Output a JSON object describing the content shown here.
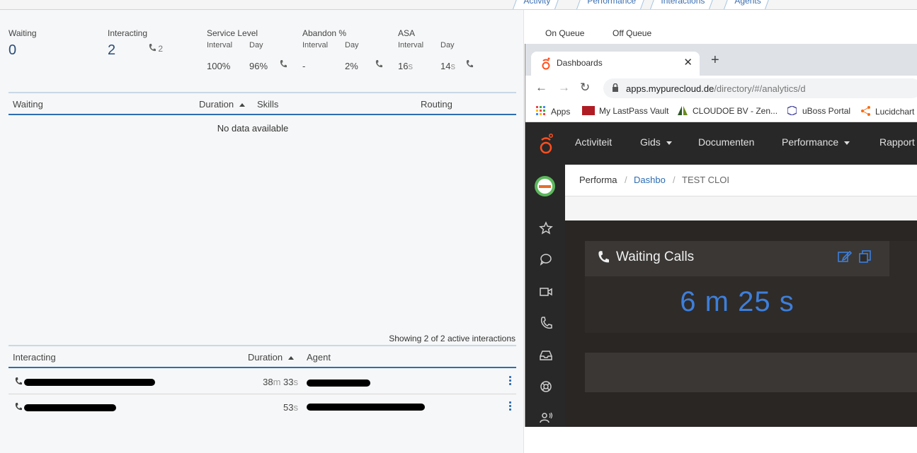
{
  "top_tabs": [
    "Activity",
    "Performance",
    "Interactions",
    "Agents"
  ],
  "stats": {
    "waiting_label": "Waiting",
    "waiting_value": "0",
    "interacting_label": "Interacting",
    "interacting_value": "2",
    "interacting_calls": "2",
    "service_level_label": "Service Level",
    "service_interval_label": "Interval",
    "service_day_label": "Day",
    "service_interval_value": "100%",
    "service_day_value": "96%",
    "abandon_label": "Abandon %",
    "abandon_interval_label": "Interval",
    "abandon_day_label": "Day",
    "abandon_interval_value": "-",
    "abandon_day_value": "2%",
    "asa_label": "ASA",
    "asa_interval_label": "Interval",
    "asa_day_label": "Day",
    "asa_interval_value": "16",
    "asa_day_value": "14",
    "seconds_unit": "s"
  },
  "waiting_table": {
    "col_waiting": "Waiting",
    "col_duration": "Duration",
    "col_skills": "Skills",
    "col_routing": "Routing",
    "empty": "No data available"
  },
  "interacting_table": {
    "summary": "Showing 2 of 2 active interactions",
    "col_interacting": "Interacting",
    "col_duration": "Duration",
    "col_agent": "Agent",
    "rows": [
      {
        "duration_m": "38",
        "m_unit": "m",
        "duration_s": "33",
        "s_unit": "s"
      },
      {
        "duration_s": "53",
        "s_unit": "s"
      }
    ]
  },
  "queue_tabs": {
    "on": "On Queue",
    "off": "Off Queue"
  },
  "browser": {
    "tab_title": "Dashboards",
    "url_host": "apps.mypurecloud.de",
    "url_path": "/directory/#/analytics/d",
    "bookmarks": [
      "Apps",
      "My LastPass Vault",
      "CLOUDOE BV - Zen...",
      "uBoss Portal",
      "Lucidchart"
    ]
  },
  "app": {
    "nav": [
      "Activiteit",
      "Gids",
      "Documenten",
      "Performance",
      "Rapport"
    ],
    "breadcrumb": [
      "Performa",
      "Dashbo",
      "TEST CLOI"
    ],
    "widget_title": "Waiting Calls",
    "widget_value": "6 m 25 s"
  },
  "colors": {
    "accent": "#2e6db3",
    "widget_value": "#3d7fdb",
    "brand_orange": "#ff4f1f"
  }
}
